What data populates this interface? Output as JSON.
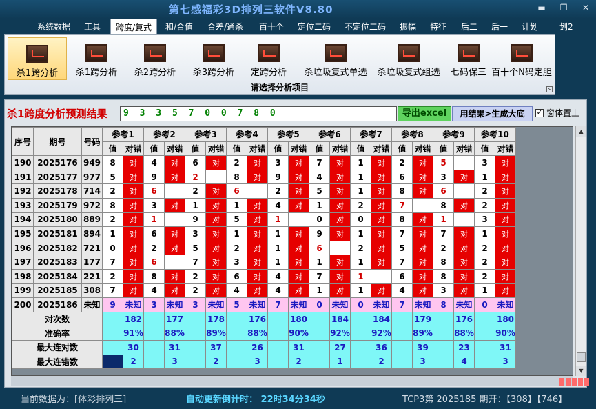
{
  "window": {
    "title": "第七感福彩3D排列三软件V8.80"
  },
  "menu": [
    "系统数据",
    "工具",
    "跨度/复式",
    "和/合值",
    "合差/通杀",
    "百十个",
    "定位二码",
    "不定位二码",
    "振幅",
    "特征",
    "后二",
    "后一",
    "计划",
    "划2"
  ],
  "ribbon": {
    "buttons": [
      "杀1跨分析",
      "杀1跨分析",
      "杀2跨分析",
      "杀3跨分析",
      "定跨分析",
      "杀垃圾复式单选",
      "杀垃圾复式组选",
      "七码保三",
      "百十个N码定胆"
    ],
    "caption": "请选择分析项目"
  },
  "panel": {
    "title": "杀1跨度分析预测结果",
    "result": "9 3 3 5 7 0 0 7 8 0",
    "excel_button": "导出excel",
    "generate_button": "用结果>生成大底",
    "topmost_label": "窗体置上",
    "topmost_checked": "✓"
  },
  "table": {
    "h_seq": "序号",
    "h_period": "期号",
    "h_num": "号码",
    "refs": [
      "参考1",
      "参考2",
      "参考3",
      "参考4",
      "参考5",
      "参考6",
      "参考7",
      "参考8",
      "参考9",
      "参考10"
    ],
    "sub_val": "值",
    "sub_res": "对错",
    "hit": "对",
    "rows": [
      {
        "seq": "190",
        "period": "2025176",
        "num": "949",
        "vals": [
          "8",
          "4",
          "6",
          "2",
          "3",
          "7",
          "1",
          "2",
          "5",
          "3"
        ],
        "red": [
          false,
          false,
          false,
          false,
          false,
          false,
          false,
          false,
          true,
          false
        ],
        "hits": [
          true,
          true,
          true,
          true,
          true,
          true,
          true,
          true,
          false,
          true
        ]
      },
      {
        "seq": "191",
        "period": "2025177",
        "num": "977",
        "vals": [
          "5",
          "9",
          "2",
          "8",
          "9",
          "4",
          "1",
          "6",
          "3",
          "1"
        ],
        "red": [
          false,
          false,
          true,
          false,
          false,
          false,
          false,
          false,
          false,
          false
        ],
        "hits": [
          true,
          true,
          false,
          true,
          true,
          true,
          true,
          true,
          true,
          true
        ]
      },
      {
        "seq": "192",
        "period": "2025178",
        "num": "714",
        "vals": [
          "2",
          "6",
          "2",
          "6",
          "2",
          "5",
          "1",
          "8",
          "6",
          "2"
        ],
        "red": [
          false,
          true,
          false,
          true,
          false,
          false,
          false,
          false,
          true,
          false
        ],
        "hits": [
          true,
          false,
          true,
          false,
          true,
          true,
          true,
          true,
          false,
          true
        ]
      },
      {
        "seq": "193",
        "period": "2025179",
        "num": "972",
        "vals": [
          "8",
          "3",
          "1",
          "1",
          "4",
          "1",
          "2",
          "7",
          "8",
          "2"
        ],
        "red": [
          false,
          false,
          false,
          false,
          false,
          false,
          false,
          true,
          false,
          false
        ],
        "hits": [
          true,
          true,
          true,
          true,
          true,
          true,
          true,
          false,
          true,
          true
        ]
      },
      {
        "seq": "194",
        "period": "2025180",
        "num": "889",
        "vals": [
          "2",
          "1",
          "9",
          "5",
          "1",
          "0",
          "0",
          "8",
          "1",
          "3"
        ],
        "red": [
          false,
          true,
          false,
          false,
          true,
          false,
          false,
          false,
          true,
          false
        ],
        "hits": [
          true,
          false,
          true,
          true,
          false,
          true,
          true,
          true,
          false,
          true
        ]
      },
      {
        "seq": "195",
        "period": "2025181",
        "num": "894",
        "vals": [
          "1",
          "6",
          "3",
          "1",
          "1",
          "9",
          "1",
          "7",
          "7",
          "1"
        ],
        "red": [
          false,
          false,
          false,
          false,
          false,
          false,
          false,
          false,
          false,
          false
        ],
        "hits": [
          true,
          true,
          true,
          true,
          true,
          true,
          true,
          true,
          true,
          true
        ]
      },
      {
        "seq": "196",
        "period": "2025182",
        "num": "721",
        "vals": [
          "0",
          "2",
          "5",
          "2",
          "1",
          "6",
          "2",
          "5",
          "2",
          "2"
        ],
        "red": [
          false,
          false,
          false,
          false,
          false,
          true,
          false,
          false,
          false,
          false
        ],
        "hits": [
          true,
          true,
          true,
          true,
          true,
          false,
          true,
          true,
          true,
          true
        ]
      },
      {
        "seq": "197",
        "period": "2025183",
        "num": "177",
        "vals": [
          "7",
          "6",
          "7",
          "3",
          "1",
          "1",
          "1",
          "7",
          "8",
          "2"
        ],
        "red": [
          false,
          true,
          false,
          false,
          false,
          false,
          false,
          false,
          false,
          false
        ],
        "hits": [
          true,
          false,
          true,
          true,
          true,
          true,
          true,
          true,
          true,
          true
        ]
      },
      {
        "seq": "198",
        "period": "2025184",
        "num": "221",
        "vals": [
          "2",
          "8",
          "2",
          "6",
          "4",
          "7",
          "1",
          "6",
          "8",
          "2"
        ],
        "red": [
          false,
          false,
          false,
          false,
          false,
          false,
          true,
          false,
          false,
          false
        ],
        "hits": [
          true,
          true,
          true,
          true,
          true,
          true,
          false,
          true,
          true,
          true
        ]
      },
      {
        "seq": "199",
        "period": "2025185",
        "num": "308",
        "vals": [
          "7",
          "4",
          "2",
          "4",
          "4",
          "1",
          "1",
          "4",
          "3",
          "1"
        ],
        "red": [
          false,
          false,
          false,
          false,
          false,
          false,
          false,
          false,
          false,
          false
        ],
        "hits": [
          true,
          true,
          true,
          true,
          true,
          true,
          true,
          true,
          true,
          true
        ]
      }
    ],
    "pending": {
      "seq": "200",
      "period": "2025186",
      "num": "未知",
      "vals": [
        "9",
        "3",
        "3",
        "5",
        "7",
        "0",
        "0",
        "7",
        "8",
        "0"
      ],
      "res": "未知"
    },
    "stats": [
      {
        "label": "对次数",
        "values": [
          "182",
          "177",
          "178",
          "176",
          "180",
          "184",
          "184",
          "179",
          "176",
          "180"
        ]
      },
      {
        "label": "准确率",
        "values": [
          "91%",
          "88%",
          "89%",
          "88%",
          "90%",
          "92%",
          "92%",
          "89%",
          "88%",
          "90%"
        ]
      },
      {
        "label": "最大连对数",
        "values": [
          "30",
          "31",
          "37",
          "26",
          "31",
          "27",
          "36",
          "39",
          "23",
          "31"
        ]
      },
      {
        "label": "最大连错数",
        "values": [
          "2",
          "3",
          "2",
          "3",
          "2",
          "1",
          "2",
          "3",
          "4",
          "3"
        ]
      }
    ]
  },
  "status": {
    "data_source": "当前数据为：[体彩排列三]",
    "countdown": "自动更新倒计时： 22时34分34秒",
    "draw": "TCP3第 2025185 期开：【308】【746】"
  }
}
